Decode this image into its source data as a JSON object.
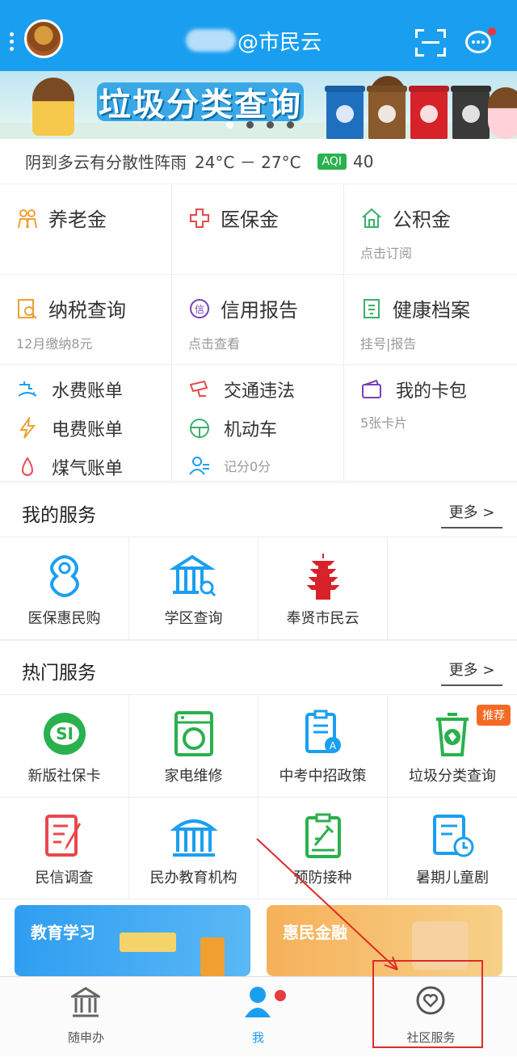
{
  "header": {
    "title": "@市民云"
  },
  "banner": {
    "title": "垃圾分类查询",
    "bins": [
      {
        "color": "#1f6fc0"
      },
      {
        "color": "#8a5a2c"
      },
      {
        "color": "#d7222a"
      },
      {
        "color": "#3a3a3a"
      }
    ]
  },
  "weather": {
    "desc": "阴到多云有分散性阵雨",
    "temp": "24°C － 27°C",
    "aqi_label": "AQI",
    "aqi_value": "40"
  },
  "quick": {
    "pension": {
      "label": "养老金",
      "sub": ""
    },
    "medical": {
      "label": "医保金",
      "sub": ""
    },
    "fund": {
      "label": "公积金",
      "sub": "点击订阅"
    },
    "tax": {
      "label": "纳税查询",
      "sub": "12月缴纳8元"
    },
    "credit": {
      "label": "信用报告",
      "sub": "点击查看"
    },
    "health": {
      "label": "健康档案",
      "sub": "挂号|报告"
    },
    "water": "水费账单",
    "electric": "电费账单",
    "gas": "煤气账单",
    "traffic": "交通违法",
    "vehicle": "机动车",
    "score": "记分0分",
    "wallet": {
      "label": "我的卡包",
      "sub": "5张卡片"
    }
  },
  "my_services": {
    "title": "我的服务",
    "more": "更多 >",
    "items": [
      "医保惠民购",
      "学区查询",
      "奉贤市民云"
    ]
  },
  "hot_services": {
    "title": "热门服务",
    "more": "更多 >",
    "tag": "推荐",
    "row1": [
      "新版社保卡",
      "家电维修",
      "中考中招政策",
      "垃圾分类查询"
    ],
    "row2": [
      "民信调查",
      "民办教育机构",
      "预防接种",
      "暑期儿童剧"
    ]
  },
  "promos": [
    "教育学习",
    "惠民金融"
  ],
  "tabs": [
    "随申办",
    "我",
    "社区服务"
  ],
  "colors": {
    "accent": "#1a9ff0",
    "tag": "#f36a23",
    "annotation": "#e02a2a"
  }
}
